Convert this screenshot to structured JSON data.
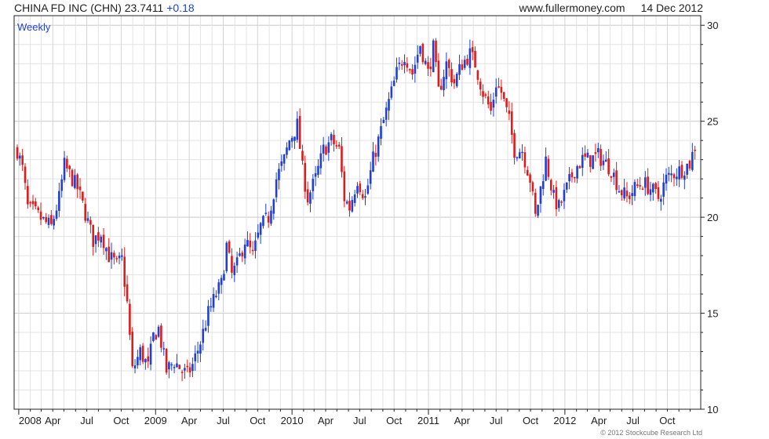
{
  "header": {
    "ticker": "CHINA FD INC (CHN) 23.7411",
    "change": "+0.18",
    "site": "www.fullermoney.com",
    "date": "14 Dec 2012"
  },
  "period_label": "Weekly",
  "copyright": "© 2012 Stockcube Research Ltd",
  "colors": {
    "up": "#1f3fd6",
    "down": "#e01b1b",
    "grid": "#e3e3e3"
  },
  "chart_data": {
    "type": "candlestick",
    "title": "CHINA FD INC (CHN)",
    "period": "Weekly",
    "y_axis_side": "right",
    "ylim": [
      10,
      30.5
    ],
    "y_ticks": [
      10,
      15,
      20,
      25,
      30
    ],
    "x_tick_labels": [
      "2008",
      "Apr",
      "Jul",
      "Oct",
      "2009",
      "Apr",
      "Jul",
      "Oct",
      "2010",
      "Apr",
      "Jul",
      "Oct",
      "2011",
      "Apr",
      "Jul",
      "Oct",
      "2012",
      "Apr",
      "Jul",
      "Oct"
    ],
    "grid": true,
    "anchor_closes": [
      [
        "2007-12-28",
        23.5
      ],
      [
        "2008-01-11",
        22.5
      ],
      [
        "2008-01-25",
        20.5
      ],
      [
        "2008-02-15",
        20.2
      ],
      [
        "2008-03-07",
        19.8
      ],
      [
        "2008-03-28",
        19.5
      ],
      [
        "2008-04-18",
        21.0
      ],
      [
        "2008-05-02",
        22.7
      ],
      [
        "2008-05-23",
        22.0
      ],
      [
        "2008-06-06",
        21.5
      ],
      [
        "2008-06-27",
        20.2
      ],
      [
        "2008-07-18",
        18.8
      ],
      [
        "2008-08-08",
        19.2
      ],
      [
        "2008-08-29",
        18.0
      ],
      [
        "2008-09-19",
        17.5
      ],
      [
        "2008-10-03",
        17.8
      ],
      [
        "2008-10-17",
        15.5
      ],
      [
        "2008-10-31",
        12.0
      ],
      [
        "2008-11-21",
        13.0
      ],
      [
        "2008-12-12",
        12.2
      ],
      [
        "2008-12-26",
        13.8
      ],
      [
        "2009-01-09",
        14.2
      ],
      [
        "2009-01-30",
        12.0
      ],
      [
        "2009-02-20",
        12.5
      ],
      [
        "2009-03-13",
        12.0
      ],
      [
        "2009-03-27",
        11.8
      ],
      [
        "2009-04-10",
        12.3
      ],
      [
        "2009-05-01",
        13.5
      ],
      [
        "2009-05-22",
        15.0
      ],
      [
        "2009-06-12",
        16.0
      ],
      [
        "2009-06-26",
        16.5
      ],
      [
        "2009-07-10",
        18.5
      ],
      [
        "2009-07-24",
        17.0
      ],
      [
        "2009-08-07",
        17.5
      ],
      [
        "2009-08-28",
        18.8
      ],
      [
        "2009-09-18",
        18.0
      ],
      [
        "2009-10-09",
        19.5
      ],
      [
        "2009-10-30",
        20.0
      ],
      [
        "2009-11-20",
        22.0
      ],
      [
        "2009-12-11",
        23.0
      ],
      [
        "2009-12-25",
        24.0
      ],
      [
        "2010-01-15",
        24.8
      ],
      [
        "2010-01-29",
        22.5
      ],
      [
        "2010-02-12",
        21.0
      ],
      [
        "2010-03-05",
        22.0
      ],
      [
        "2010-03-26",
        23.5
      ],
      [
        "2010-04-16",
        24.0
      ],
      [
        "2010-05-07",
        23.5
      ],
      [
        "2010-05-21",
        21.0
      ],
      [
        "2010-06-04",
        20.5
      ],
      [
        "2010-06-25",
        22.0
      ],
      [
        "2010-07-16",
        21.0
      ],
      [
        "2010-08-06",
        23.0
      ],
      [
        "2010-08-27",
        24.5
      ],
      [
        "2010-09-17",
        26.0
      ],
      [
        "2010-10-08",
        27.5
      ],
      [
        "2010-10-29",
        28.5
      ],
      [
        "2010-11-19",
        27.5
      ],
      [
        "2010-12-10",
        29.0
      ],
      [
        "2010-12-31",
        27.5
      ],
      [
        "2011-01-14",
        28.8
      ],
      [
        "2011-01-28",
        26.5
      ],
      [
        "2011-02-18",
        28.0
      ],
      [
        "2011-03-11",
        27.0
      ],
      [
        "2011-04-01",
        28.0
      ],
      [
        "2011-04-22",
        28.5
      ],
      [
        "2011-05-06",
        28.0
      ],
      [
        "2011-05-27",
        26.5
      ],
      [
        "2011-06-17",
        25.5
      ],
      [
        "2011-07-01",
        27.0
      ],
      [
        "2011-07-15",
        26.5
      ],
      [
        "2011-08-05",
        25.0
      ],
      [
        "2011-08-19",
        23.5
      ],
      [
        "2011-09-09",
        23.5
      ],
      [
        "2011-09-30",
        22.0
      ],
      [
        "2011-10-14",
        20.0
      ],
      [
        "2011-10-28",
        21.5
      ],
      [
        "2011-11-11",
        23.0
      ],
      [
        "2011-12-02",
        21.0
      ],
      [
        "2011-12-16",
        20.5
      ],
      [
        "2012-01-06",
        21.5
      ],
      [
        "2012-01-27",
        22.5
      ],
      [
        "2012-02-17",
        23.0
      ],
      [
        "2012-03-09",
        23.0
      ],
      [
        "2012-03-30",
        23.2
      ],
      [
        "2012-04-20",
        22.8
      ],
      [
        "2012-05-04",
        22.5
      ],
      [
        "2012-05-25",
        21.5
      ],
      [
        "2012-06-15",
        21.0
      ],
      [
        "2012-07-06",
        21.5
      ],
      [
        "2012-07-27",
        21.8
      ],
      [
        "2012-08-17",
        21.5
      ],
      [
        "2012-09-07",
        21.0
      ],
      [
        "2012-09-28",
        22.0
      ],
      [
        "2012-10-19",
        22.3
      ],
      [
        "2012-11-09",
        22.5
      ],
      [
        "2012-11-30",
        22.8
      ],
      [
        "2012-12-14",
        23.74
      ]
    ]
  }
}
